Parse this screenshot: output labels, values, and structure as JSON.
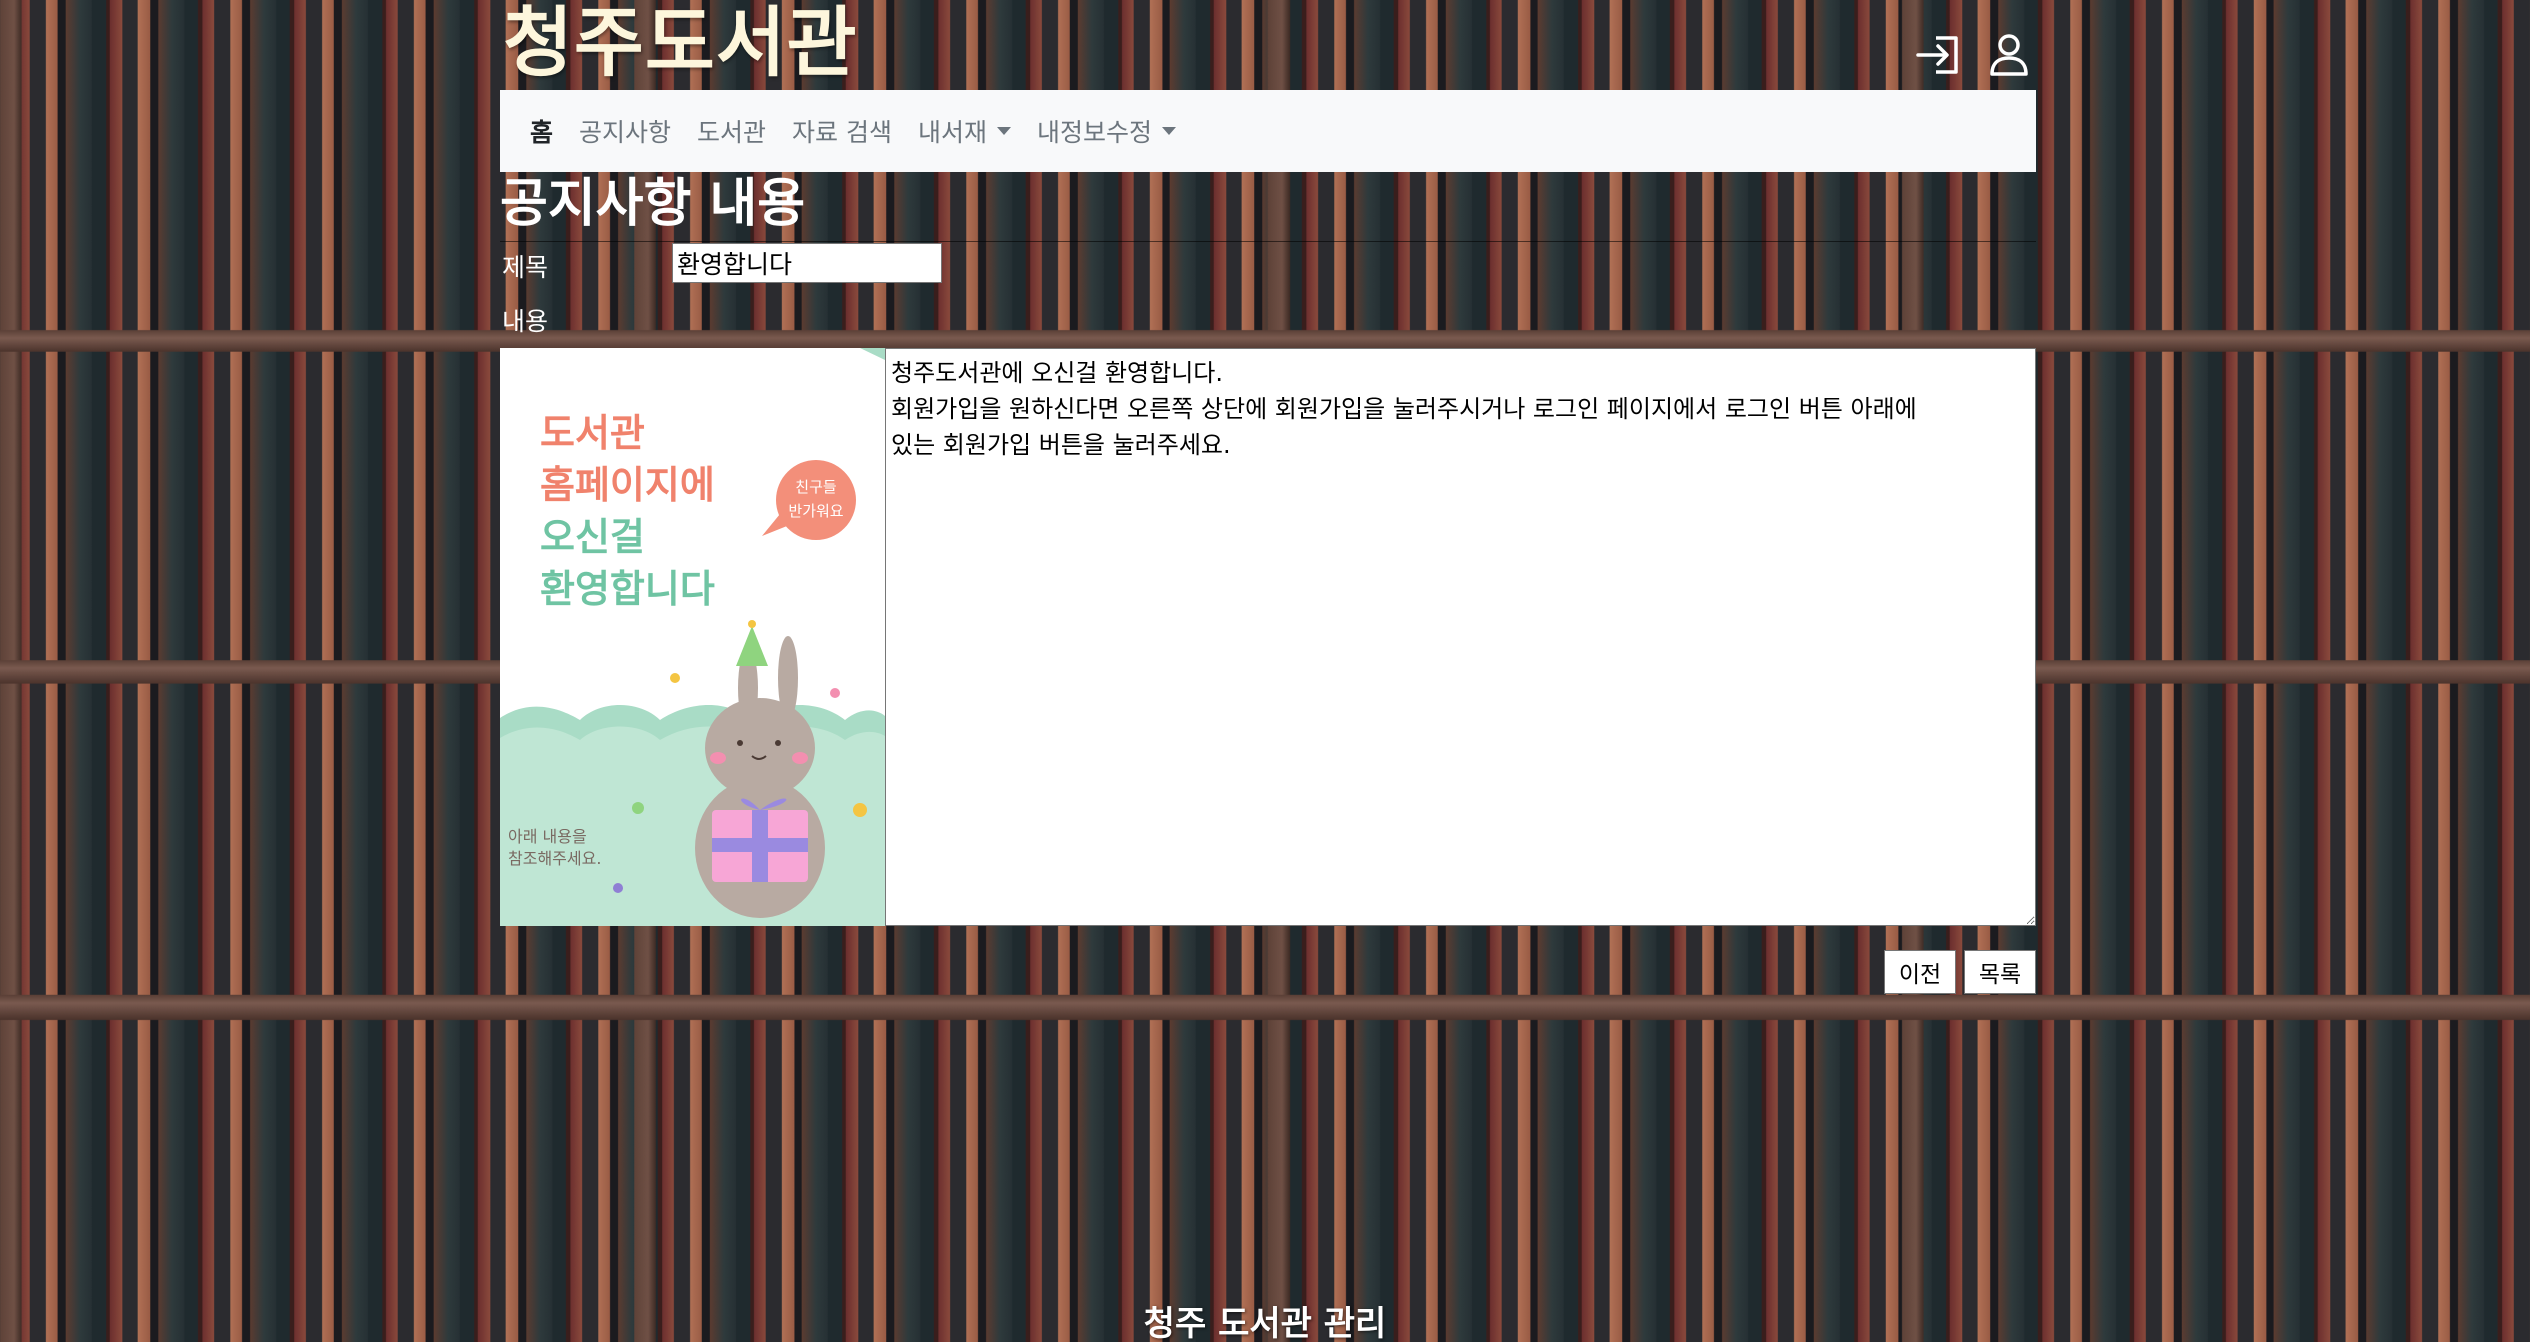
{
  "header": {
    "site_title": "청주도서관",
    "icons": [
      "login-icon",
      "user-icon"
    ]
  },
  "nav": {
    "items": [
      {
        "label": "홈",
        "active": true,
        "dropdown": false
      },
      {
        "label": "공지사항",
        "active": false,
        "dropdown": false
      },
      {
        "label": "도서관",
        "active": false,
        "dropdown": false
      },
      {
        "label": "자료 검색",
        "active": false,
        "dropdown": false
      },
      {
        "label": "내서재",
        "active": false,
        "dropdown": true
      },
      {
        "label": "내정보수정",
        "active": false,
        "dropdown": true
      }
    ]
  },
  "notice": {
    "heading": "공지사항 내용",
    "title_label": "제목",
    "title_value": "환영합니다",
    "content_label": "내용",
    "content_value": "청주도서관에 오신걸 환영합니다.\n회원가입을 원하신다면 오른쪽 상단에 회원가입을 눌러주시거나 로그인 페이지에서 로그인 버튼 아래에\n있는 회원가입 버튼을 눌러주세요."
  },
  "poster": {
    "line1": "도서관",
    "line2": "홈페이지에",
    "line3": "오신걸",
    "line4": "환영합니다",
    "bubble_line1": "친구들",
    "bubble_line2": "반가워요",
    "note_line1": "아래 내용을",
    "note_line2": "참조해주세요.",
    "colors": {
      "pink": "#f0826c",
      "mint": "#6fc4a3",
      "bg_mint": "#bfe6d4"
    }
  },
  "buttons": {
    "prev_label": "이전",
    "list_label": "목록"
  },
  "footer": {
    "text": "청주 도서관 관리"
  }
}
